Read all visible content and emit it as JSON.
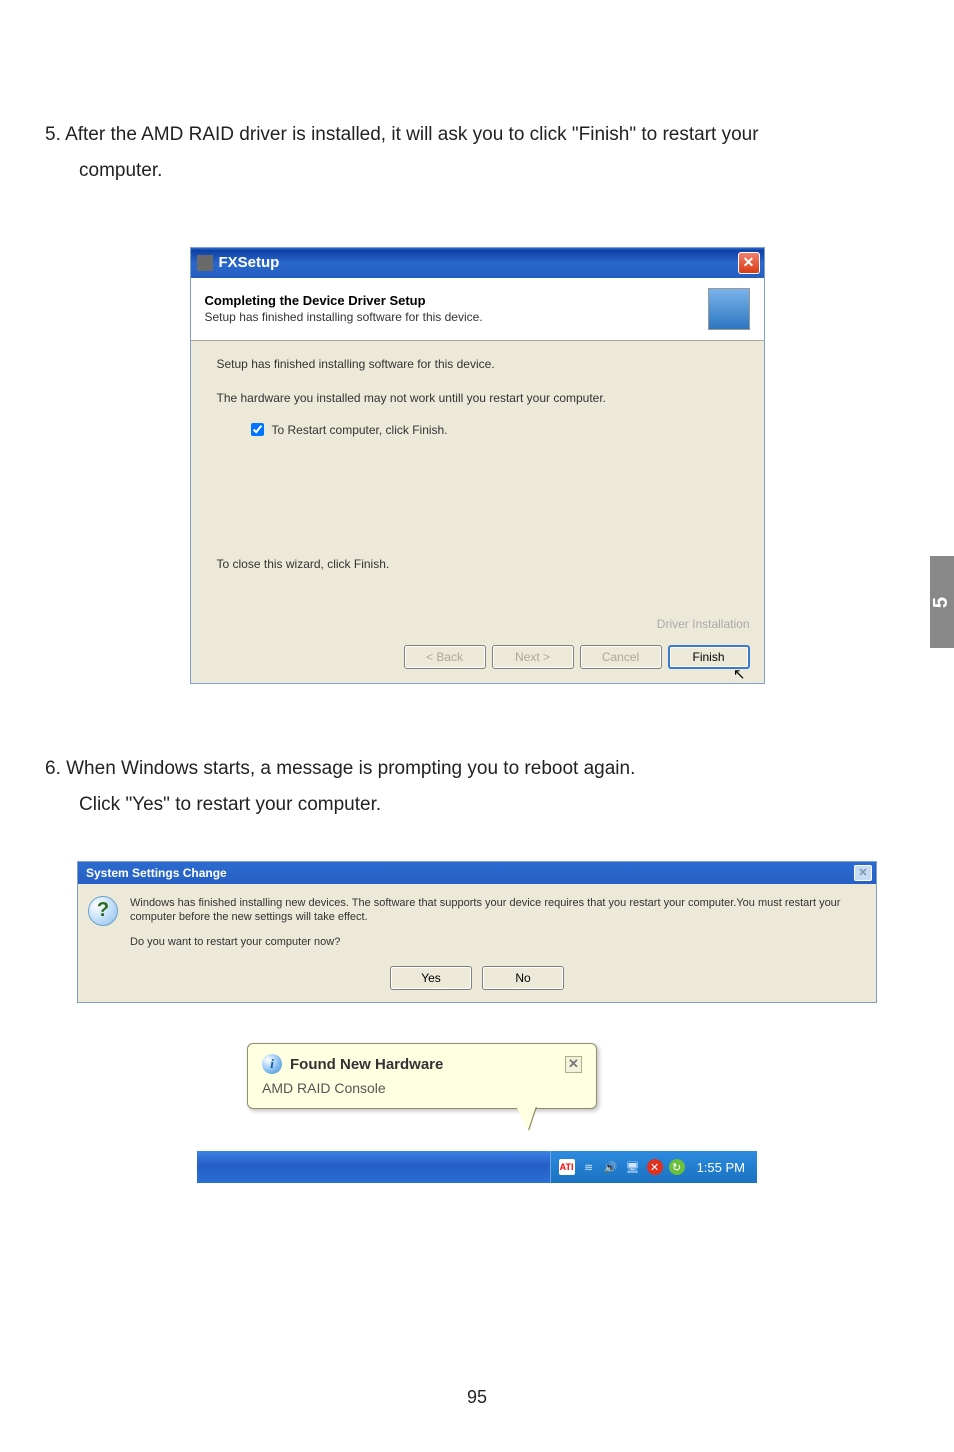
{
  "side_tab": "5",
  "step5": {
    "line1": "5. After the AMD RAID driver is installed, it will ask you to click \"Finish\" to restart your",
    "line2": "computer."
  },
  "step6": {
    "line1": "6. When Windows starts, a message is prompting you to reboot again.",
    "line2": "Click \"Yes\" to restart your computer."
  },
  "fxsetup": {
    "title": "FXSetup",
    "header_title": "Completing the Device Driver Setup",
    "header_sub": "Setup has finished installing software for this device.",
    "body1": "Setup has finished installing software for this device.",
    "body2": "The hardware you installed may not work untill you restart your computer.",
    "check_label": "To Restart computer, click Finish.",
    "close_wiz": "To close this wizard, click Finish.",
    "driver_installation": "Driver Installation",
    "back": "< Back",
    "next": "Next >",
    "cancel": "Cancel",
    "finish": "Finish"
  },
  "ssc": {
    "title": "System Settings Change",
    "body1": "Windows has finished installing new devices. The software that supports your device requires that you restart your computer.You must restart your computer before the new settings will take effect.",
    "body2": "Do you want to restart your computer now?",
    "yes": "Yes",
    "no": "No"
  },
  "balloon": {
    "title": "Found New Hardware",
    "body": "AMD RAID Console"
  },
  "tray": {
    "ati": "ATI",
    "time": "1:55 PM"
  },
  "page_num": "95"
}
